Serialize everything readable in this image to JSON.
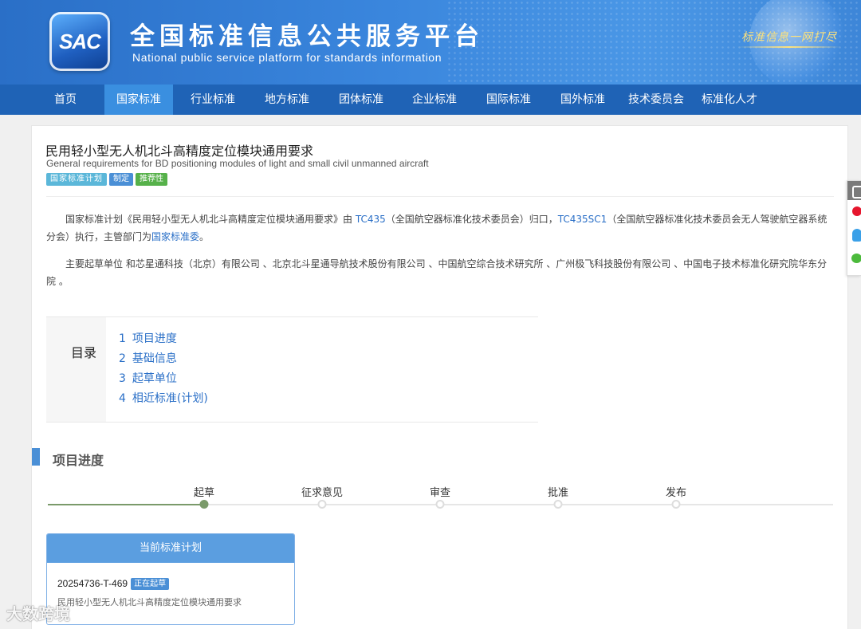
{
  "header": {
    "logo_text": "SAC",
    "title_cn": "全国标准信息公共服务平台",
    "title_en": "National public service platform  for standards information",
    "slogan": "标准信息一网打尽"
  },
  "nav": {
    "items": [
      "首页",
      "国家标准",
      "行业标准",
      "地方标准",
      "团体标准",
      "企业标准",
      "国际标准",
      "国外标准",
      "技术委员会",
      "标准化人才"
    ],
    "active_index": 1
  },
  "standard": {
    "title_cn": "民用轻小型无人机北斗高精度定位模块通用要求",
    "title_en": "General requirements for BD positioning modules of light and small civil unmanned aircraft",
    "tags": [
      "国家标准计划",
      "制定",
      "推荐性"
    ]
  },
  "description": {
    "p1_a": "国家标准计划《民用轻小型无人机北斗高精度定位模块通用要求》由 ",
    "p1_link1": "TC435",
    "p1_b": "（全国航空器标准化技术委员会）归口，",
    "p1_link2": "TC435SC1",
    "p1_c": "（全国航空器标准化技术委员会无人驾驶航空器系统分会）执行，主管部门为",
    "p1_link3": "国家标准委",
    "p1_d": "。",
    "p2": "主要起草单位 和芯星通科技（北京）有限公司 、北京北斗星通导航技术股份有限公司 、中国航空综合技术研究所 、广州极飞科技股份有限公司 、中国电子技术标准化研究院华东分院 。"
  },
  "toc": {
    "label": "目录",
    "items": [
      {
        "num": "1",
        "label": "项目进度"
      },
      {
        "num": "2",
        "label": "基础信息"
      },
      {
        "num": "3",
        "label": "起草单位"
      },
      {
        "num": "4",
        "label": "相近标准(计划)"
      }
    ]
  },
  "progress": {
    "section_title": "项目进度",
    "steps": [
      "起草",
      "征求意见",
      "审查",
      "批准",
      "发布"
    ],
    "current_step": 1
  },
  "plan": {
    "header": "当前标准计划",
    "code": "20254736-T-469",
    "status": "正在起草",
    "name": "民用轻小型无人机北斗高精度定位模块通用要求"
  },
  "watermark": "大数跨境",
  "share_icons": [
    "copy-icon",
    "weibo-icon",
    "qq-icon",
    "wechat-icon"
  ]
}
